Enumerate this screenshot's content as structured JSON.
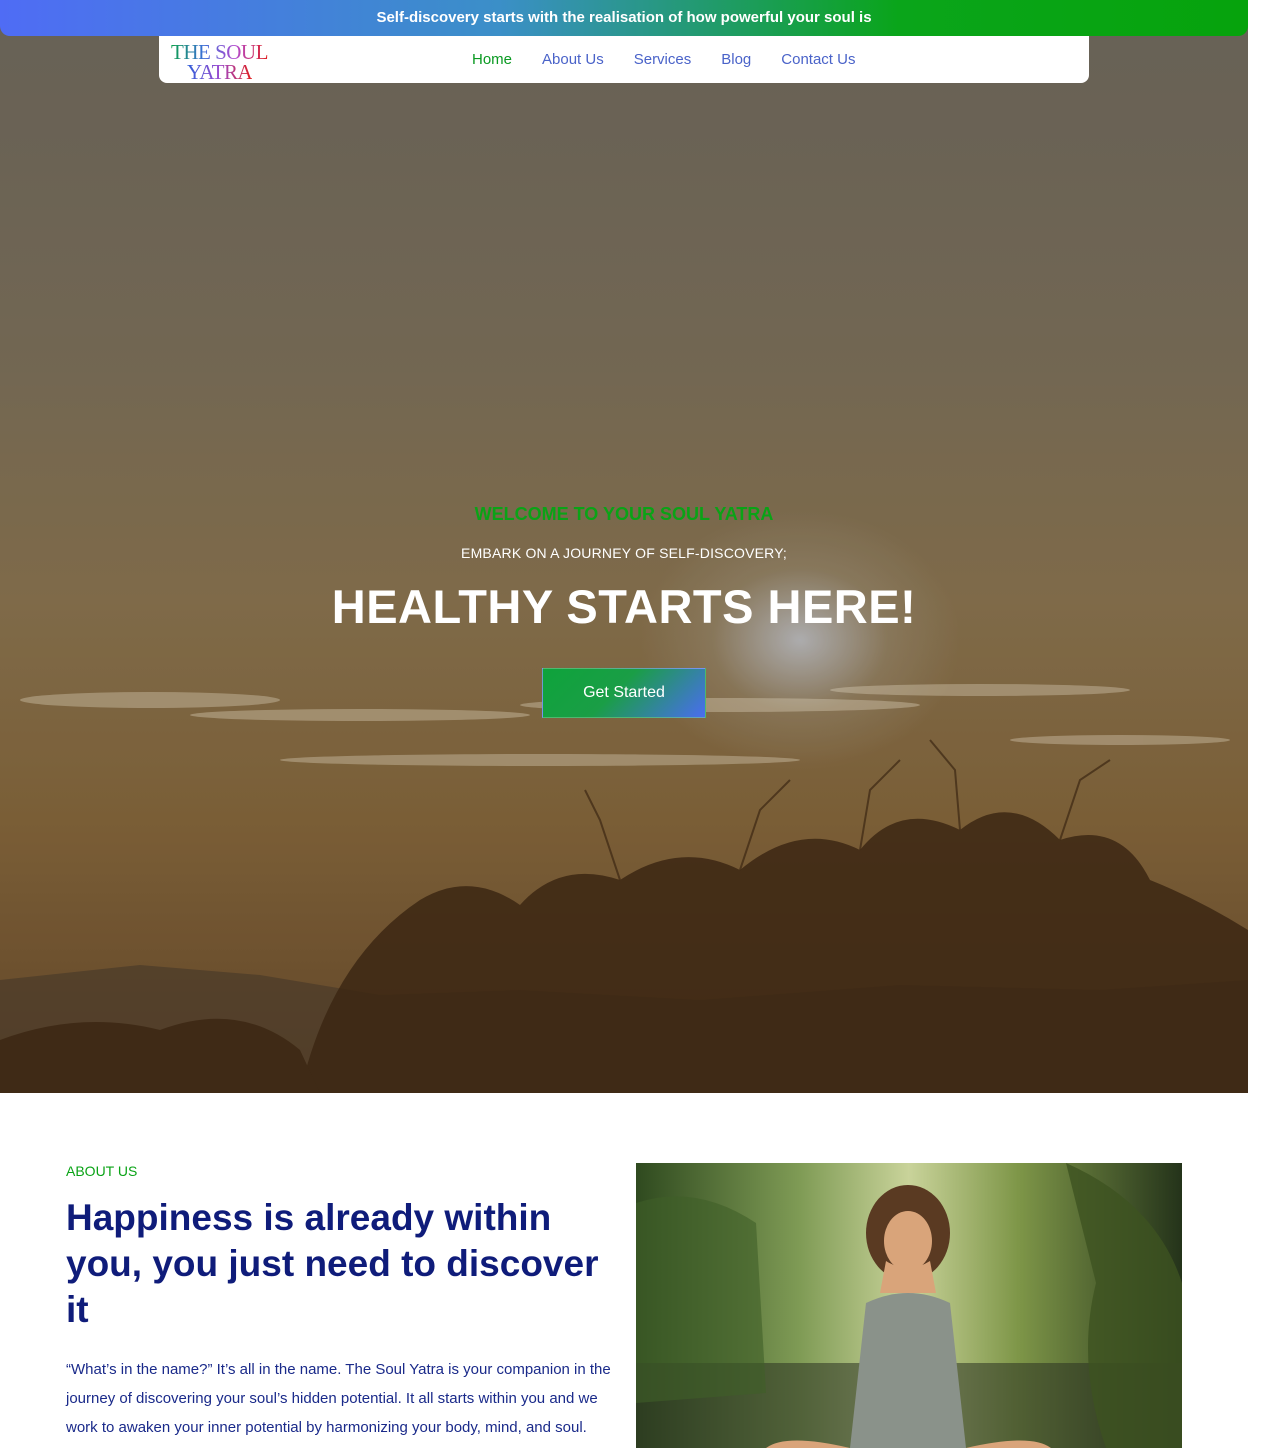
{
  "announcement": {
    "text": "Self-discovery starts with the realisation of how powerful your soul is"
  },
  "logo": {
    "line1": "THE SOUL",
    "line2": "YATRA"
  },
  "nav": {
    "items": [
      {
        "label": "Home",
        "active": true
      },
      {
        "label": "About Us",
        "active": false
      },
      {
        "label": "Services",
        "active": false
      },
      {
        "label": "Blog",
        "active": false
      },
      {
        "label": "Contact Us",
        "active": false
      }
    ]
  },
  "hero": {
    "eyebrow": "WELCOME TO YOUR SOUL YATRA",
    "subtitle": "EMBARK ON A JOURNEY OF SELF-DISCOVERY;",
    "headline": "HEALTHY STARTS HERE!",
    "cta_label": "Get Started"
  },
  "about": {
    "label": "ABOUT US",
    "title": "Happiness is already within you, you just need to discover it",
    "body": "“What’s in the name?” It’s all in the name. The Soul Yatra is your companion in the journey of discovering your soul’s hidden potential. It all starts within you and we work to awaken your inner potential by harmonizing your body, mind, and soul."
  },
  "colors": {
    "brand_green": "#0aa316",
    "brand_blue": "#4a63c9",
    "heading_navy": "#0f1c7a"
  }
}
